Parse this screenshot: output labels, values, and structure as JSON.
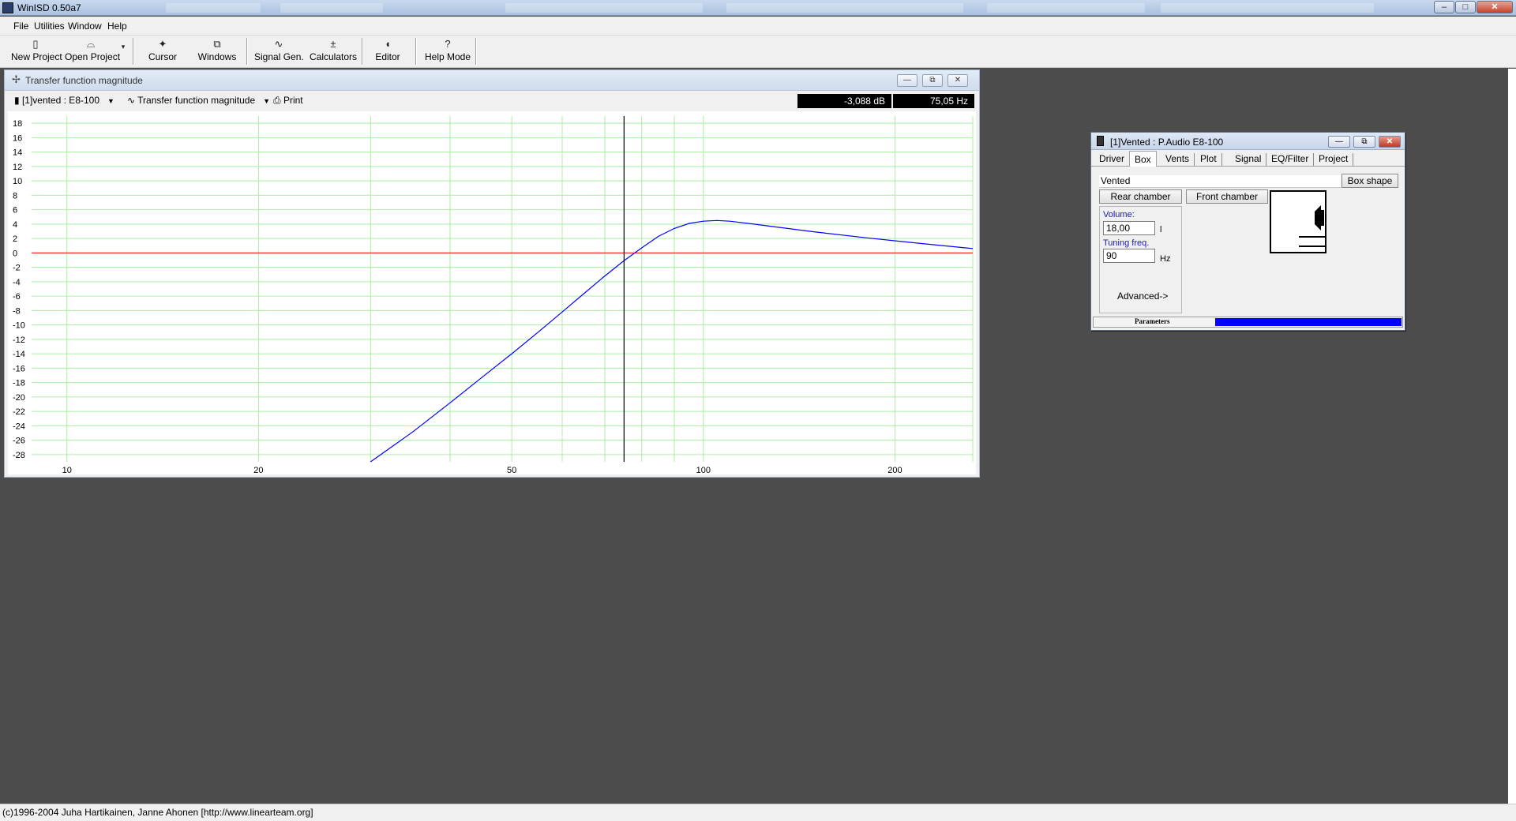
{
  "app": {
    "title": "WinISD 0.50a7",
    "footer": "(c)1996-2004 Juha Hartikainen, Janne Ahonen [http://www.linearteam.org]"
  },
  "menu": [
    {
      "label": "File"
    },
    {
      "label": "Utilities"
    },
    {
      "label": "Window"
    },
    {
      "label": "Help"
    }
  ],
  "toolbar": {
    "new_project": "New Project",
    "open_project": "Open Project",
    "cursor": "Cursor",
    "windows": "Windows",
    "signal_gen": "Signal Gen.",
    "calculators": "Calculators",
    "editor": "Editor",
    "help_mode": "Help Mode"
  },
  "chart_window": {
    "title": "Transfer function magnitude",
    "project_select": "[1]vented : E8-100",
    "graph_select": "Transfer function magnitude",
    "print": "Print",
    "readout_db": "-3,088 dB",
    "readout_hz": "75,05 Hz"
  },
  "chart_data": {
    "type": "line",
    "xscale": "log",
    "xlim": [
      8.8,
      265
    ],
    "ylim": [
      -29,
      19
    ],
    "grid": true,
    "x_ticks": [
      "10",
      "20",
      "50",
      "100",
      "200"
    ],
    "y_ticks": [
      "18",
      "16",
      "14",
      "12",
      "10",
      "8",
      "6",
      "4",
      "2",
      "0",
      "-2",
      "-4",
      "-6",
      "-8",
      "-10",
      "-12",
      "-14",
      "-16",
      "-18",
      "-20",
      "-22",
      "-24",
      "-26",
      "-28"
    ],
    "reference_line": {
      "y": 0,
      "color": "#ff0000"
    },
    "cursor": {
      "x": 75.05,
      "color": "#000000"
    },
    "series": [
      {
        "color": "#0000ff",
        "x": [
          30,
          35,
          40,
          45,
          50,
          55,
          60,
          65,
          70,
          75,
          80,
          85,
          90,
          95,
          100,
          105,
          110,
          120,
          130,
          150,
          180,
          220,
          265
        ],
        "y": [
          -29.2,
          -24.8,
          -20.8,
          -17.2,
          -14.0,
          -11.0,
          -8.2,
          -5.6,
          -3.2,
          -1.1,
          0.7,
          2.3,
          3.4,
          4.1,
          4.4,
          4.5,
          4.4,
          4.0,
          3.6,
          2.9,
          2.1,
          1.3,
          0.6
        ]
      }
    ]
  },
  "box_window": {
    "title": "[1]Vented : P.Audio  E8-100",
    "tabs": [
      "Driver",
      "Box",
      "Vents",
      "Plot",
      "Signal",
      "EQ/Filter",
      "Project"
    ],
    "active_tab": "Box",
    "box_type": "Vented",
    "box_shape_button": "Box shape",
    "rear_chamber": "Rear chamber",
    "front_chamber": "Front chamber",
    "volume_label": "Volume:",
    "volume_value": "18,00",
    "volume_unit": "l",
    "tuning_label": "Tuning freq.",
    "tuning_value": "90",
    "tuning_unit": "Hz",
    "advanced": "Advanced->",
    "status_label": "Parameters",
    "status_color": "#0000ff"
  }
}
